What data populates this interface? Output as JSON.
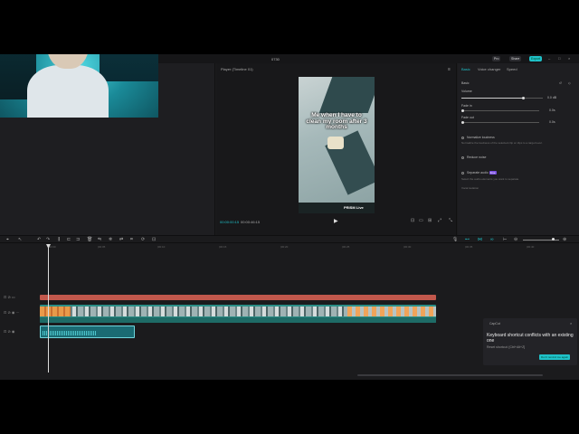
{
  "titlebar": {
    "title": "0730",
    "pro_label": "Pro",
    "share_label": "Share",
    "export_label": "Export"
  },
  "player": {
    "title": "Player (Timeline 01)",
    "caption": "Me when I have to clean my room after 3 months",
    "brand": "PRISM Live",
    "current_time": "00:00:00:15",
    "total_time": "00:00:46:15"
  },
  "inspector": {
    "tabs": [
      "Basic",
      "Voice changer",
      "Speed"
    ],
    "basic_label": "Basic",
    "volume_label": "Volume",
    "volume_value": "0.0 dB",
    "fade_in_label": "Fade in",
    "fade_in_value": "0.0s",
    "fade_out_label": "Fade out",
    "fade_out_value": "0.0s",
    "normalize_label": "Normalize loudness",
    "normalize_desc": "Normalize the loudness of the selected clip or clips to a target level.",
    "reduce_noise_label": "Reduce noise",
    "separate_label": "Separate audio",
    "separate_badge": "Free",
    "separate_desc": "Select the audio elements you want to separate.",
    "vocal_label": "Vocal isolation"
  },
  "timeline": {
    "ruler": [
      "00:00",
      "|00:05",
      "|00:10",
      "|00:15",
      "|00:20",
      "|00:25",
      "|00:30",
      "|00:35",
      "|00:40"
    ]
  },
  "toast": {
    "source": "CapCut",
    "message": "Keyboard shortcut conflicts with an existing one",
    "detail": "Reset shortcut: [Ctrl+Alt+Z]",
    "button": "Don't remind me again"
  },
  "colors": {
    "accent": "#1fc1c8",
    "text_track": "#c2584c",
    "video_track": "#2a8e86"
  }
}
